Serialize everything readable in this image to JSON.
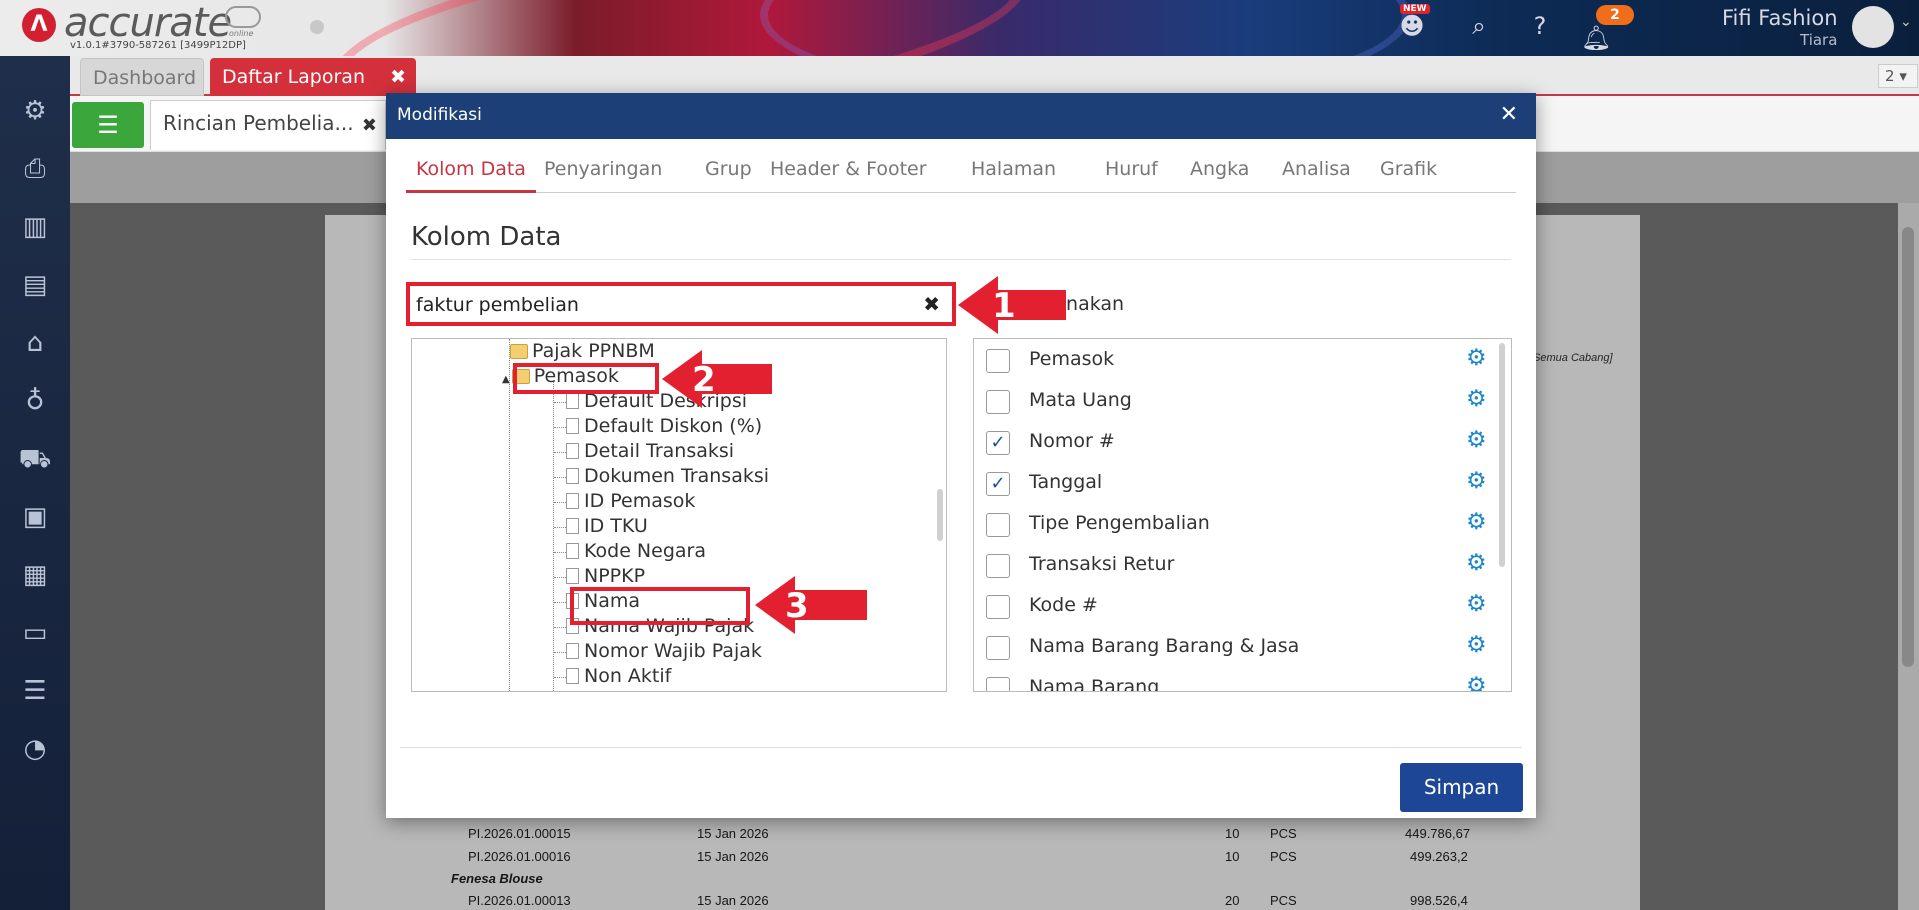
{
  "app": {
    "logo_text": "accurate",
    "logo_sub": "online",
    "version": "v1.0.1#3790-587261 [3499P12DP]",
    "new_badge": "NEW",
    "notification_count": "2",
    "user_name": "Fifi Fashion",
    "user_sub": "Tiara"
  },
  "tabs": {
    "dashboard": "Dashboard",
    "daftar_laporan": "Daftar Laporan",
    "page_select": "2"
  },
  "subtab": {
    "label": "Rincian Pembelia..."
  },
  "report": {
    "cabang_note": "[Semua Cabang]",
    "rows": [
      {
        "no": "PI.2026.01.00015",
        "date": "15 Jan 2026",
        "qty": "10",
        "unit": "PCS",
        "amount": "449.786,67"
      },
      {
        "no": "PI.2026.01.00016",
        "date": "15 Jan 2026",
        "qty": "10",
        "unit": "PCS",
        "amount": "499.263,2"
      }
    ],
    "group_label": "Fenesa Blouse",
    "row3": {
      "no": "PI.2026.01.00013",
      "date": "15 Jan 2026",
      "qty": "20",
      "unit": "PCS",
      "amount": "998.526,4"
    }
  },
  "modal": {
    "title": "Modifikasi",
    "tabs": [
      "Kolom Data",
      "Penyaringan",
      "Grup",
      "Header & Footer",
      "Halaman",
      "Huruf",
      "Angka",
      "Analisa",
      "Grafik"
    ],
    "section_title": "Kolom Data",
    "search_value": "faktur pembelian",
    "used_label": "unakan",
    "save_label": "Simpan"
  },
  "tree": {
    "folders": [
      "Pajak PPNBM",
      "Pemasok"
    ],
    "items": [
      "Default Deskripsi",
      "Default Diskon (%)",
      "Detail Transaksi",
      "Dokumen Transaksi",
      "ID Pemasok",
      "ID TKU",
      "Kode Negara",
      "NPPKP",
      "Nama",
      "Nama Wajib Pajak",
      "Nomor Wajib Pajak",
      "Non Aktif"
    ]
  },
  "columns": [
    {
      "label": "Pemasok",
      "checked": false
    },
    {
      "label": "Mata Uang",
      "checked": false
    },
    {
      "label": "Nomor #",
      "checked": true
    },
    {
      "label": "Tanggal",
      "checked": true
    },
    {
      "label": "Tipe Pengembalian",
      "checked": false
    },
    {
      "label": "Transaksi Retur",
      "checked": false
    },
    {
      "label": "Kode #",
      "checked": false
    },
    {
      "label": "Nama Barang Barang & Jasa",
      "checked": false
    },
    {
      "label": "Nama Barang",
      "checked": false
    }
  ],
  "annotations": {
    "step1": "1",
    "step2": "2",
    "step3": "3",
    "color": "#e3202f"
  },
  "colors": {
    "modal_header": "#1d3f77",
    "active_tab": "#c53542",
    "save_button": "#1d4796",
    "gear": "#1d87c9"
  },
  "icons": {
    "sidebar": [
      "gear-icon",
      "printer-icon",
      "building-icon",
      "book-icon",
      "bank-icon",
      "money-bag-icon",
      "cart-icon",
      "package-icon",
      "factory-icon",
      "conveyor-icon",
      "tax-icon",
      "report-icon"
    ],
    "topbar": [
      "mascot-icon",
      "search-icon",
      "help-icon",
      "bell-icon"
    ]
  }
}
